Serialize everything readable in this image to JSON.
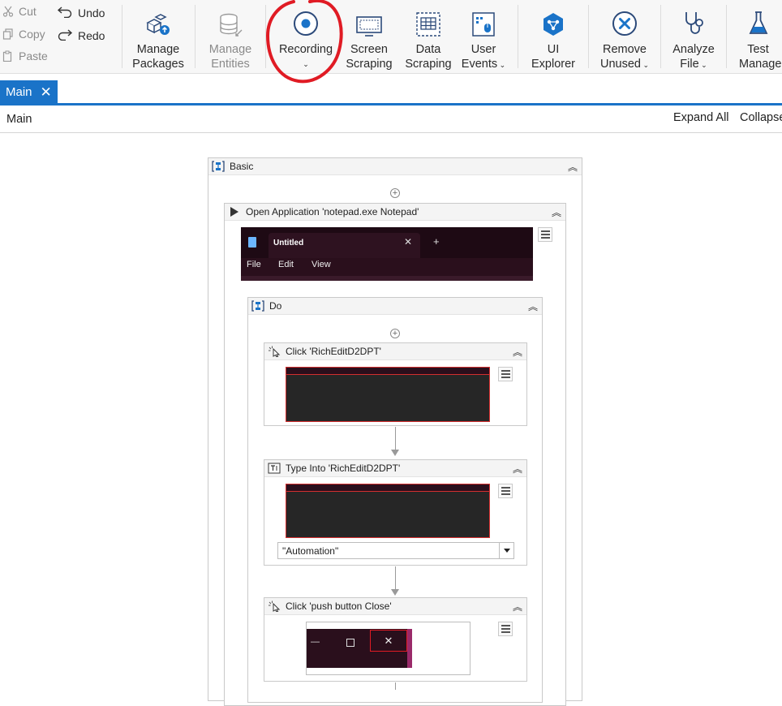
{
  "ribbon": {
    "clipboard": {
      "cut": "Cut",
      "copy": "Copy",
      "paste": "Paste"
    },
    "undo": "Undo",
    "redo": "Redo",
    "manage_packages": [
      "Manage",
      "Packages"
    ],
    "manage_entities": [
      "Manage",
      "Entities"
    ],
    "recording": [
      "Recording"
    ],
    "screen_scraping": [
      "Screen",
      "Scraping"
    ],
    "data_scraping": [
      "Data",
      "Scraping"
    ],
    "user_events": [
      "User",
      "Events"
    ],
    "ui_explorer": [
      "UI",
      "Explorer"
    ],
    "remove_unused": [
      "Remove",
      "Unused"
    ],
    "analyze_file": [
      "Analyze",
      "File"
    ],
    "test_manager": [
      "Test",
      "Manage"
    ]
  },
  "tabs": [
    {
      "label": "Main"
    }
  ],
  "breadcrumb": "Main",
  "actions": {
    "expand_all": "Expand All",
    "collapse_all": "Collapse"
  },
  "workflow": {
    "basic": {
      "title": "Basic"
    },
    "open_app": {
      "title": "Open Application 'notepad.exe  Notepad'",
      "preview": {
        "tab_title": "Untitled",
        "menu": [
          "File",
          "Edit",
          "View"
        ]
      }
    },
    "do": {
      "title": "Do"
    },
    "click1": {
      "title": "Click 'RichEditD2DPT'"
    },
    "type_into": {
      "title": "Type Into 'RichEditD2DPT'",
      "text_value": "\"Automation\""
    },
    "click2": {
      "title": "Click 'push button  Close'"
    }
  },
  "colors": {
    "accent": "#1a73c8",
    "annotation_red": "#e01b24",
    "selection_red": "#d32f2f"
  }
}
